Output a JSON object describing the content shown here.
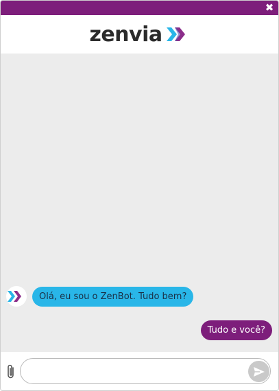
{
  "header": {
    "logo_text": "zenvia"
  },
  "topbar": {
    "close_glyph": "✖"
  },
  "messages": {
    "bot": "Olá, eu sou o ZenBot. Tudo bem?",
    "user": "Tudo e você?"
  },
  "composer": {
    "value": "",
    "placeholder": ""
  },
  "colors": {
    "brand_purple": "#7d1e7b",
    "bot_bubble": "#29b6e8",
    "chat_bg": "#ececec"
  },
  "icons": {
    "attach": "paperclip-icon",
    "send": "send-icon",
    "close": "close-icon"
  }
}
